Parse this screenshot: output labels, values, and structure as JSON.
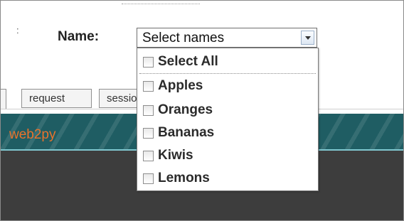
{
  "form": {
    "name_label": "Name:",
    "select_value": "Select names"
  },
  "dropdown": {
    "select_all_label": "Select All",
    "options": [
      {
        "label": "Apples",
        "checked": false
      },
      {
        "label": "Oranges",
        "checked": false
      },
      {
        "label": "Bananas",
        "checked": false
      },
      {
        "label": "Kiwis",
        "checked": false
      },
      {
        "label": "Lemons",
        "checked": false
      }
    ]
  },
  "tabs": [
    "request",
    "session"
  ],
  "brand": {
    "name": "web2py",
    "color": "#e8732c",
    "banner_color": "#1f5d63"
  }
}
